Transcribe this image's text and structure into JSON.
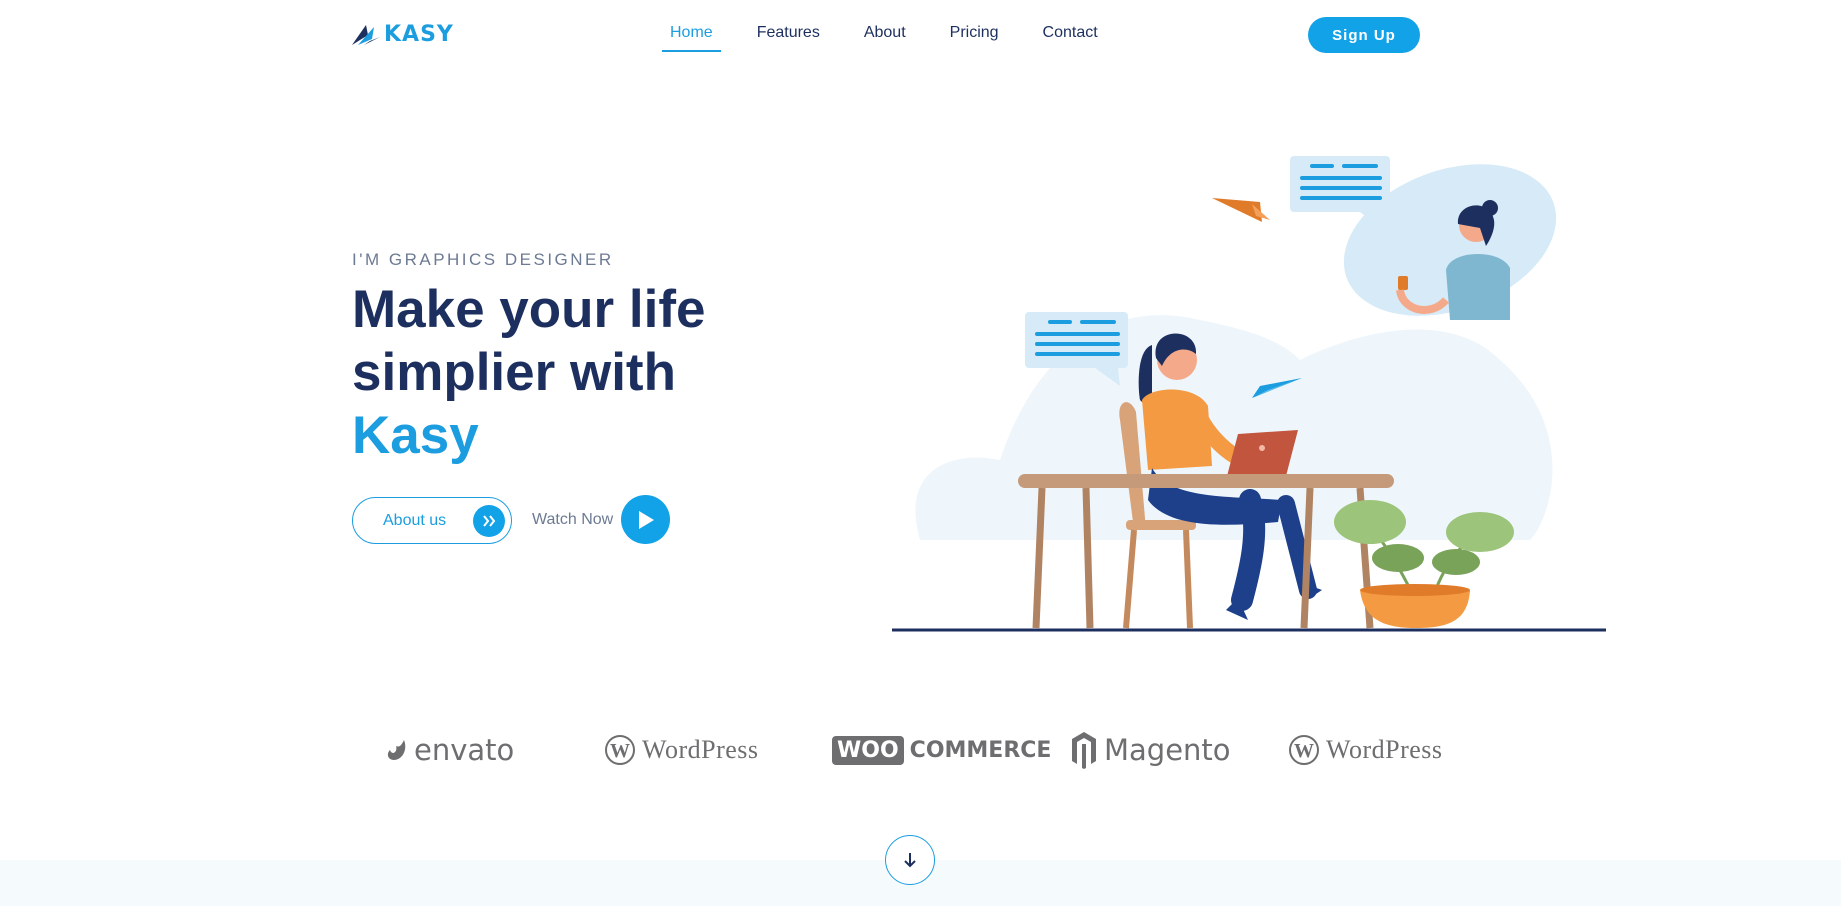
{
  "brand": {
    "name": "KASY",
    "accent_color": "#1b9de0",
    "dark_color": "#1c2f5e"
  },
  "nav": {
    "items": [
      {
        "label": "Home",
        "active": true
      },
      {
        "label": "Features",
        "active": false
      },
      {
        "label": "About",
        "active": false
      },
      {
        "label": "Pricing",
        "active": false
      },
      {
        "label": "Contact",
        "active": false
      }
    ],
    "signup_label": "Sign Up"
  },
  "hero": {
    "eyebrow": "I'M GRAPHICS DESIGNER",
    "headline_line1": "Make your life",
    "headline_line2": "simplier with",
    "headline_accent": "Kasy",
    "about_label": "About us",
    "about_icon": "double-chevron-right-icon",
    "watch_label": "Watch Now",
    "watch_icon": "play-icon"
  },
  "partners": [
    {
      "name": "envato",
      "icon": "envato-leaf-icon"
    },
    {
      "name": "WordPress",
      "icon": "wordpress-icon"
    },
    {
      "name_box": "WOO",
      "name_rest": "COMMERCE",
      "icon": "woocommerce-icon"
    },
    {
      "name": "Magento",
      "icon": "magento-icon"
    },
    {
      "name": "WordPress",
      "icon": "wordpress-icon"
    }
  ],
  "scroll_down": {
    "icon": "arrow-down-icon"
  }
}
